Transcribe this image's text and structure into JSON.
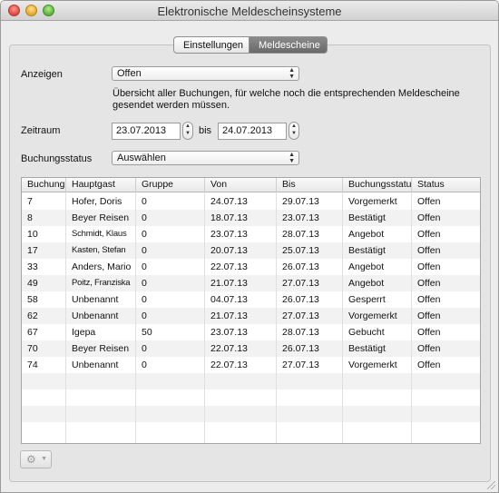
{
  "window": {
    "title": "Elektronische Meldescheinsysteme"
  },
  "tabs": [
    {
      "label": "Einstellungen",
      "selected": false
    },
    {
      "label": "Meldescheine",
      "selected": true
    }
  ],
  "filters": {
    "anzeigen_label": "Anzeigen",
    "anzeigen_value": "Offen",
    "description": "Übersicht aller Buchungen, für welche noch die entsprechenden Meldescheine gesendet werden müssen.",
    "zeitraum_label": "Zeitraum",
    "date_from": "23.07.2013",
    "bis_label": "bis",
    "date_to": "24.07.2013",
    "buchungsstatus_label": "Buchungsstatus",
    "buchungsstatus_value": "Auswählen"
  },
  "table": {
    "columns": [
      "Buchung",
      "Hauptgast",
      "Gruppe",
      "Von",
      "Bis",
      "Buchungsstatus",
      "Status"
    ],
    "rows": [
      [
        "7",
        "Hofer, Doris",
        "0",
        "24.07.13",
        "29.07.13",
        "Vorgemerkt",
        "Offen"
      ],
      [
        "8",
        "Beyer Reisen",
        "0",
        "18.07.13",
        "23.07.13",
        "Bestätigt",
        "Offen"
      ],
      [
        "10",
        "Schmidt, Klaus",
        "0",
        "23.07.13",
        "28.07.13",
        "Angebot",
        "Offen"
      ],
      [
        "17",
        "Kasten, Stefan",
        "0",
        "20.07.13",
        "25.07.13",
        "Bestätigt",
        "Offen"
      ],
      [
        "33",
        "Anders, Mario",
        "0",
        "22.07.13",
        "26.07.13",
        "Angebot",
        "Offen"
      ],
      [
        "49",
        "Poitz, Franziska",
        "0",
        "21.07.13",
        "27.07.13",
        "Angebot",
        "Offen"
      ],
      [
        "58",
        "Unbenannt",
        "0",
        "04.07.13",
        "26.07.13",
        "Gesperrt",
        "Offen"
      ],
      [
        "62",
        "Unbenannt",
        "0",
        "21.07.13",
        "27.07.13",
        "Vorgemerkt",
        "Offen"
      ],
      [
        "67",
        "Igepa",
        "50",
        "23.07.13",
        "28.07.13",
        "Gebucht",
        "Offen"
      ],
      [
        "70",
        "Beyer Reisen",
        "0",
        "22.07.13",
        "26.07.13",
        "Bestätigt",
        "Offen"
      ],
      [
        "74",
        "Unbenannt",
        "0",
        "22.07.13",
        "27.07.13",
        "Vorgemerkt",
        "Offen"
      ]
    ]
  },
  "toolbar": {
    "gear_icon": "gear-icon"
  }
}
